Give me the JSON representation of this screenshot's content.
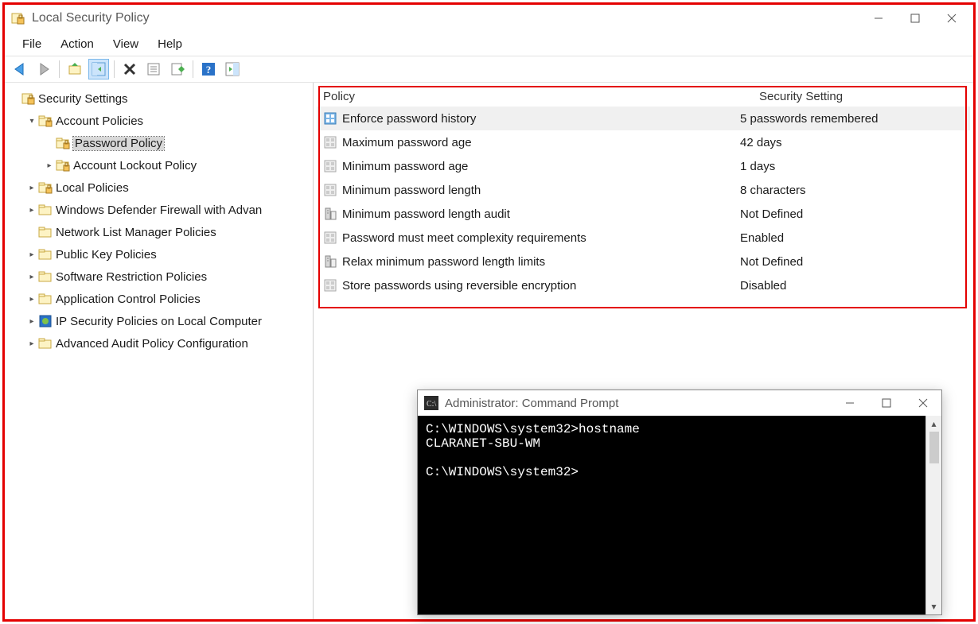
{
  "window": {
    "title": "Local Security Policy",
    "menus": [
      "File",
      "Action",
      "View",
      "Help"
    ]
  },
  "tree": {
    "root": "Security Settings",
    "nodes": [
      {
        "label": "Account Policies",
        "indent": 1,
        "twisty": "open",
        "icon": "folder-locked",
        "children": [
          {
            "label": "Password Policy",
            "indent": 2,
            "twisty": "none",
            "icon": "folder-locked",
            "selected": true
          },
          {
            "label": "Account Lockout Policy",
            "indent": 2,
            "twisty": "closed",
            "icon": "folder-locked"
          }
        ]
      },
      {
        "label": "Local Policies",
        "indent": 1,
        "twisty": "closed",
        "icon": "folder-locked"
      },
      {
        "label": "Windows Defender Firewall with Advan",
        "indent": 1,
        "twisty": "closed",
        "icon": "folder"
      },
      {
        "label": "Network List Manager Policies",
        "indent": 1,
        "twisty": "none",
        "icon": "folder"
      },
      {
        "label": "Public Key Policies",
        "indent": 1,
        "twisty": "closed",
        "icon": "folder"
      },
      {
        "label": "Software Restriction Policies",
        "indent": 1,
        "twisty": "closed",
        "icon": "folder"
      },
      {
        "label": "Application Control Policies",
        "indent": 1,
        "twisty": "closed",
        "icon": "folder"
      },
      {
        "label": "IP Security Policies on Local Computer",
        "indent": 1,
        "twisty": "closed",
        "icon": "ipsec"
      },
      {
        "label": "Advanced Audit Policy Configuration",
        "indent": 1,
        "twisty": "closed",
        "icon": "folder"
      }
    ]
  },
  "grid": {
    "headers": {
      "policy": "Policy",
      "setting": "Security Setting"
    },
    "rows": [
      {
        "policy": "Enforce password history",
        "setting": "5 passwords remembered",
        "icon": "doc-blue",
        "selected": true
      },
      {
        "policy": "Maximum password age",
        "setting": "42 days",
        "icon": "doc"
      },
      {
        "policy": "Minimum password age",
        "setting": "1 days",
        "icon": "doc"
      },
      {
        "policy": "Minimum password length",
        "setting": "8 characters",
        "icon": "doc"
      },
      {
        "policy": "Minimum password length audit",
        "setting": "Not Defined",
        "icon": "server"
      },
      {
        "policy": "Password must meet complexity requirements",
        "setting": "Enabled",
        "icon": "doc"
      },
      {
        "policy": "Relax minimum password length limits",
        "setting": "Not Defined",
        "icon": "server"
      },
      {
        "policy": "Store passwords using reversible encryption",
        "setting": "Disabled",
        "icon": "doc"
      }
    ]
  },
  "cmd": {
    "title": "Administrator: Command Prompt",
    "lines": [
      "C:\\WINDOWS\\system32>hostname",
      "CLARANET-SBU-WM",
      "",
      "C:\\WINDOWS\\system32>"
    ]
  }
}
